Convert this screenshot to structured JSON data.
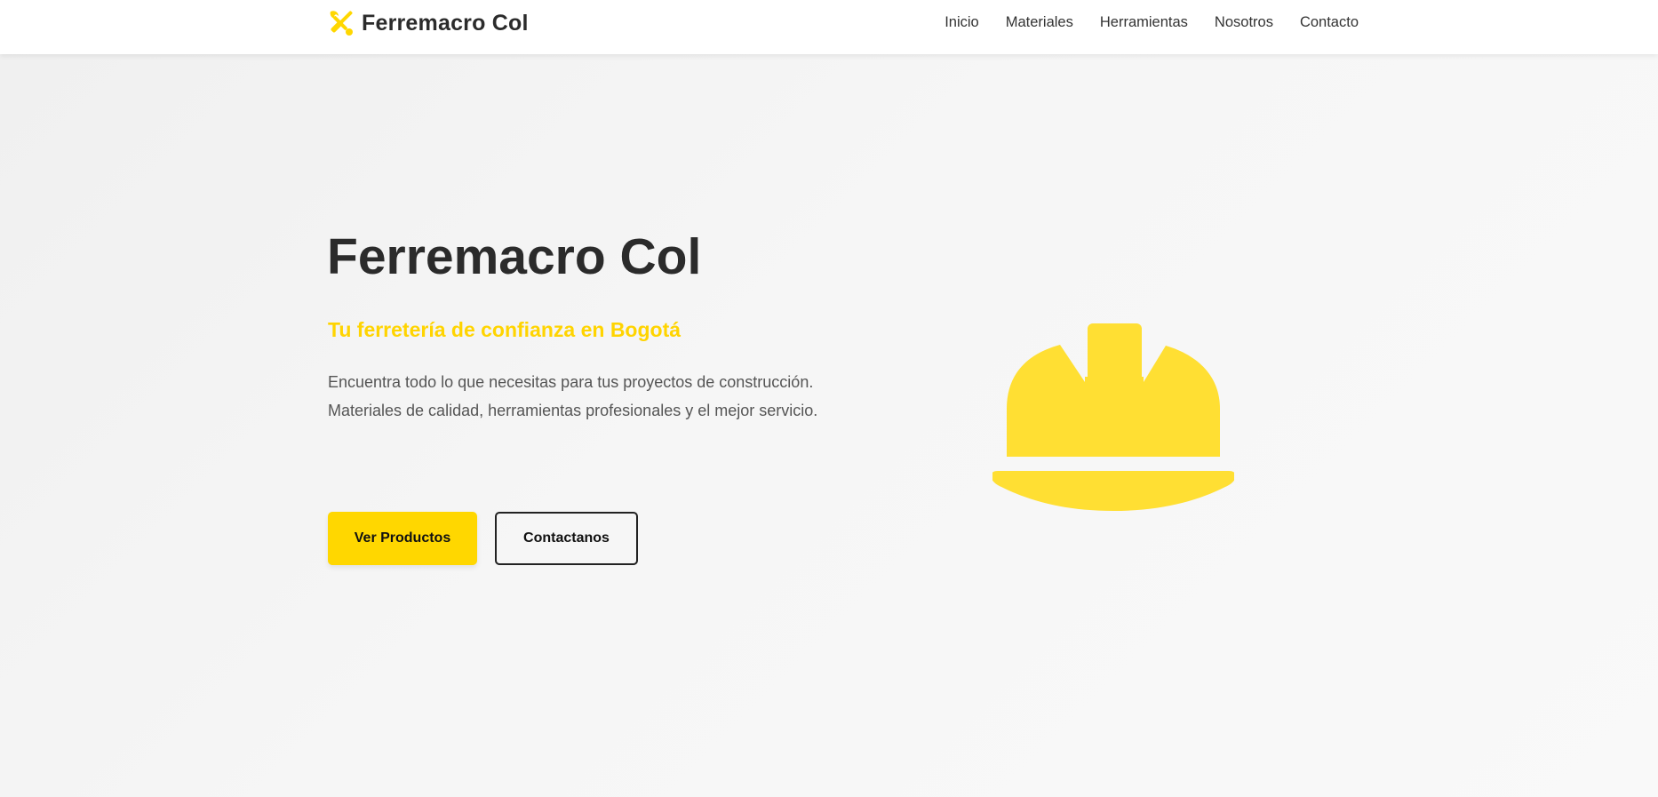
{
  "nav": {
    "brand": "Ferremacro Col",
    "brand_icon": "tools-icon",
    "links": [
      "Inicio",
      "Materiales",
      "Herramientas",
      "Nosotros",
      "Contacto"
    ]
  },
  "hero": {
    "title": "Ferremacro Col",
    "subtitle": "Tu ferretería de confianza en Bogotá",
    "description": [
      "Encuentra todo lo que necesitas para tus proyectos de construcción.",
      "Materiales de calidad, herramientas profesionales y el mejor servicio."
    ],
    "primary_button": "Ver Productos",
    "secondary_button": "Contactanos",
    "illustration": "hard-hat-icon"
  },
  "colors": {
    "accent": "#ffd700",
    "helmet": "#ffdf33",
    "text_dark": "#2b2b2b",
    "text_body": "#555555",
    "background": "#f7f7f7"
  }
}
